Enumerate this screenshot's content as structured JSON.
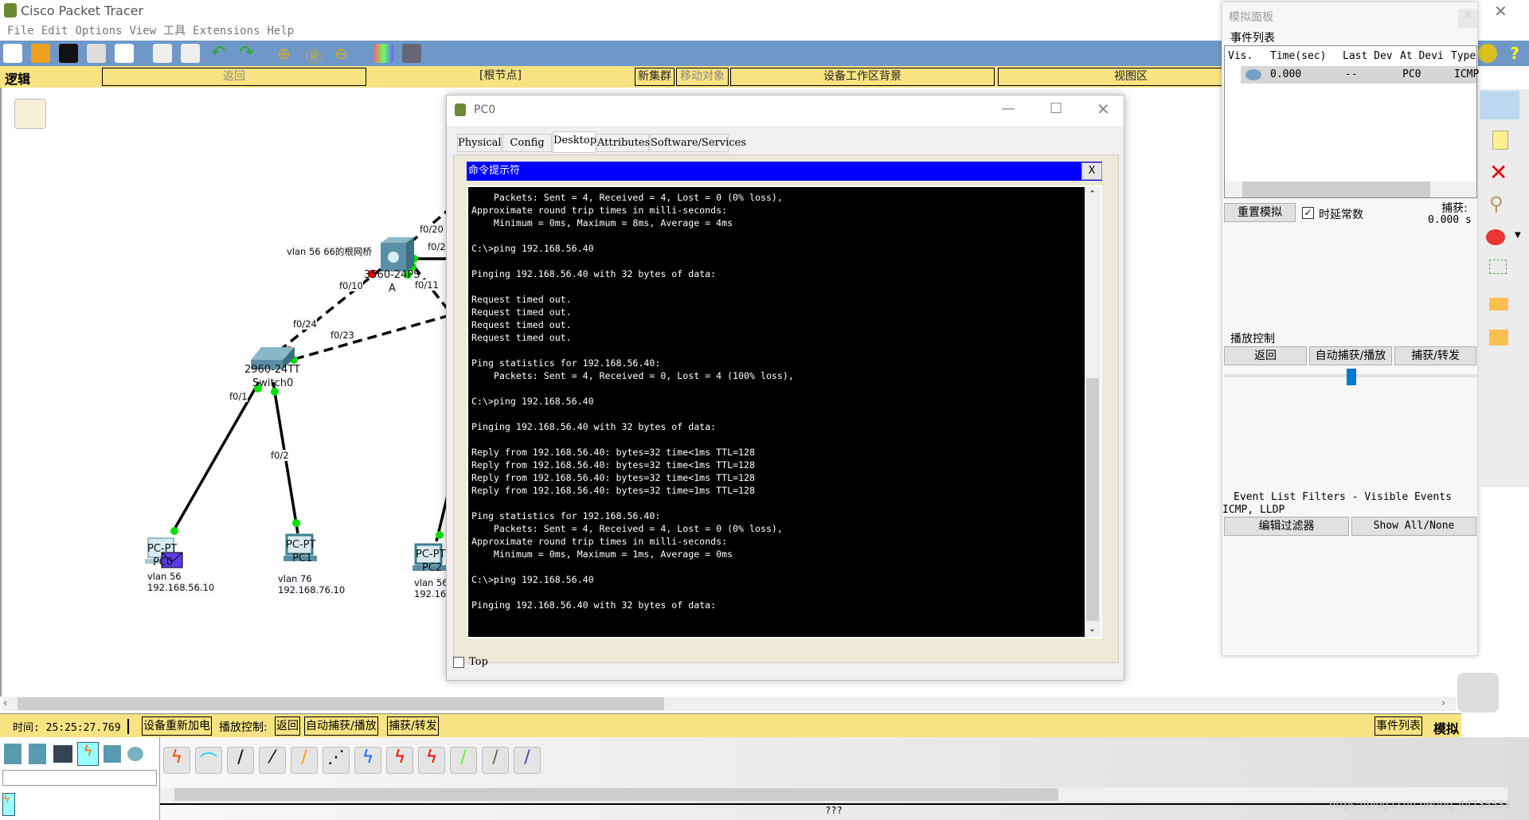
{
  "app": {
    "title": "Cisco Packet Tracer"
  },
  "menu": [
    "File",
    "Edit",
    "Options",
    "View",
    "工具",
    "Extensions",
    "Help"
  ],
  "workspace_bar": {
    "mode": "逻辑",
    "back": "返回",
    "root": "[根节点]",
    "new_cluster": "新集群",
    "move_object": "移动对象",
    "workspace_bg": "设备工作区背景",
    "viewport": "视图区"
  },
  "topology": {
    "note": "vlan 56 66的根网桥",
    "ports": [
      "f0/20",
      "f0/24",
      "f0/11",
      "f0/10",
      "f0/24",
      "f0/23",
      "f0/1",
      "f0/2",
      "f0/2"
    ],
    "devices": [
      {
        "model": "3560-24PS",
        "name": "A"
      },
      {
        "model": "2960-24TT",
        "name": "Switch0"
      },
      {
        "model": "PC-PT",
        "name": "PC0",
        "vlan": "vlan 56",
        "ip": "192.168.56.10"
      },
      {
        "model": "PC-PT",
        "name": "PC1",
        "vlan": "vlan 76",
        "ip": "192.168.76.10"
      },
      {
        "model": "PC-PT",
        "name": "PC2",
        "vlan": "vlan 56",
        "ip": "192.16"
      }
    ],
    "link_colors": {
      "up": "#00e000",
      "down": "#ff0000"
    }
  },
  "pc_window": {
    "title": "PC0",
    "tabs": [
      "Physical",
      "Config",
      "Desktop",
      "Attributes",
      "Software/Services"
    ],
    "active_tab": "Desktop",
    "cmd_title": "命令提示符",
    "cmd_close": "X",
    "terminal_lines": [
      "    Packets: Sent = 4, Received = 4, Lost = 0 (0% loss),",
      "Approximate round trip times in milli-seconds:",
      "    Minimum = 0ms, Maximum = 8ms, Average = 4ms",
      "",
      "C:\\>ping 192.168.56.40",
      "",
      "Pinging 192.168.56.40 with 32 bytes of data:",
      "",
      "Request timed out.",
      "Request timed out.",
      "Request timed out.",
      "Request timed out.",
      "",
      "Ping statistics for 192.168.56.40:",
      "    Packets: Sent = 4, Received = 0, Lost = 4 (100% loss),",
      "",
      "C:\\>ping 192.168.56.40",
      "",
      "Pinging 192.168.56.40 with 32 bytes of data:",
      "",
      "Reply from 192.168.56.40: bytes=32 time<1ms TTL=128",
      "Reply from 192.168.56.40: bytes=32 time<1ms TTL=128",
      "Reply from 192.168.56.40: bytes=32 time<1ms TTL=128",
      "Reply from 192.168.56.40: bytes=32 time=1ms TTL=128",
      "",
      "Ping statistics for 192.168.56.40:",
      "    Packets: Sent = 4, Received = 4, Lost = 0 (0% loss),",
      "Approximate round trip times in milli-seconds:",
      "    Minimum = 0ms, Maximum = 1ms, Average = 0ms",
      "",
      "C:\\>ping 192.168.56.40",
      "",
      "Pinging 192.168.56.40 with 32 bytes of data:"
    ],
    "top_checkbox": {
      "label": "Top",
      "checked": false
    }
  },
  "sim_panel": {
    "title": "模拟面板",
    "close": "×",
    "event_list_label": "事件列表",
    "columns": [
      "Vis.",
      "Time(sec)",
      "Last Dev",
      "At Devi",
      "Type"
    ],
    "events": [
      {
        "time": "0.000",
        "last": "--",
        "at": "PC0",
        "type": "ICMP"
      }
    ],
    "reset": "重置模拟",
    "constant_delay": "时延常数",
    "constant_delay_checked": true,
    "captured_label": "捕获:",
    "captured_value": "0.000 s",
    "play_label": "播放控制",
    "back": "返回",
    "auto": "自动捕获/播放",
    "capture": "捕获/转发",
    "filters_label": "Event List Filters - Visible Events",
    "filters_value": "ICMP, LLDP",
    "edit_filters": "编辑过滤器",
    "show_all": "Show All/None"
  },
  "status": {
    "time": "时间: 25:25:27.769",
    "power": "设备重新加电",
    "play": "播放控制:",
    "back": "返回",
    "auto": "自动捕获/播放",
    "capture": "捕获/转发",
    "event_list": "事件列表",
    "mode": "模拟"
  },
  "bottom": {
    "device_label": "???",
    "watermark": "https://blog.csdn.net/qq_44735538"
  }
}
